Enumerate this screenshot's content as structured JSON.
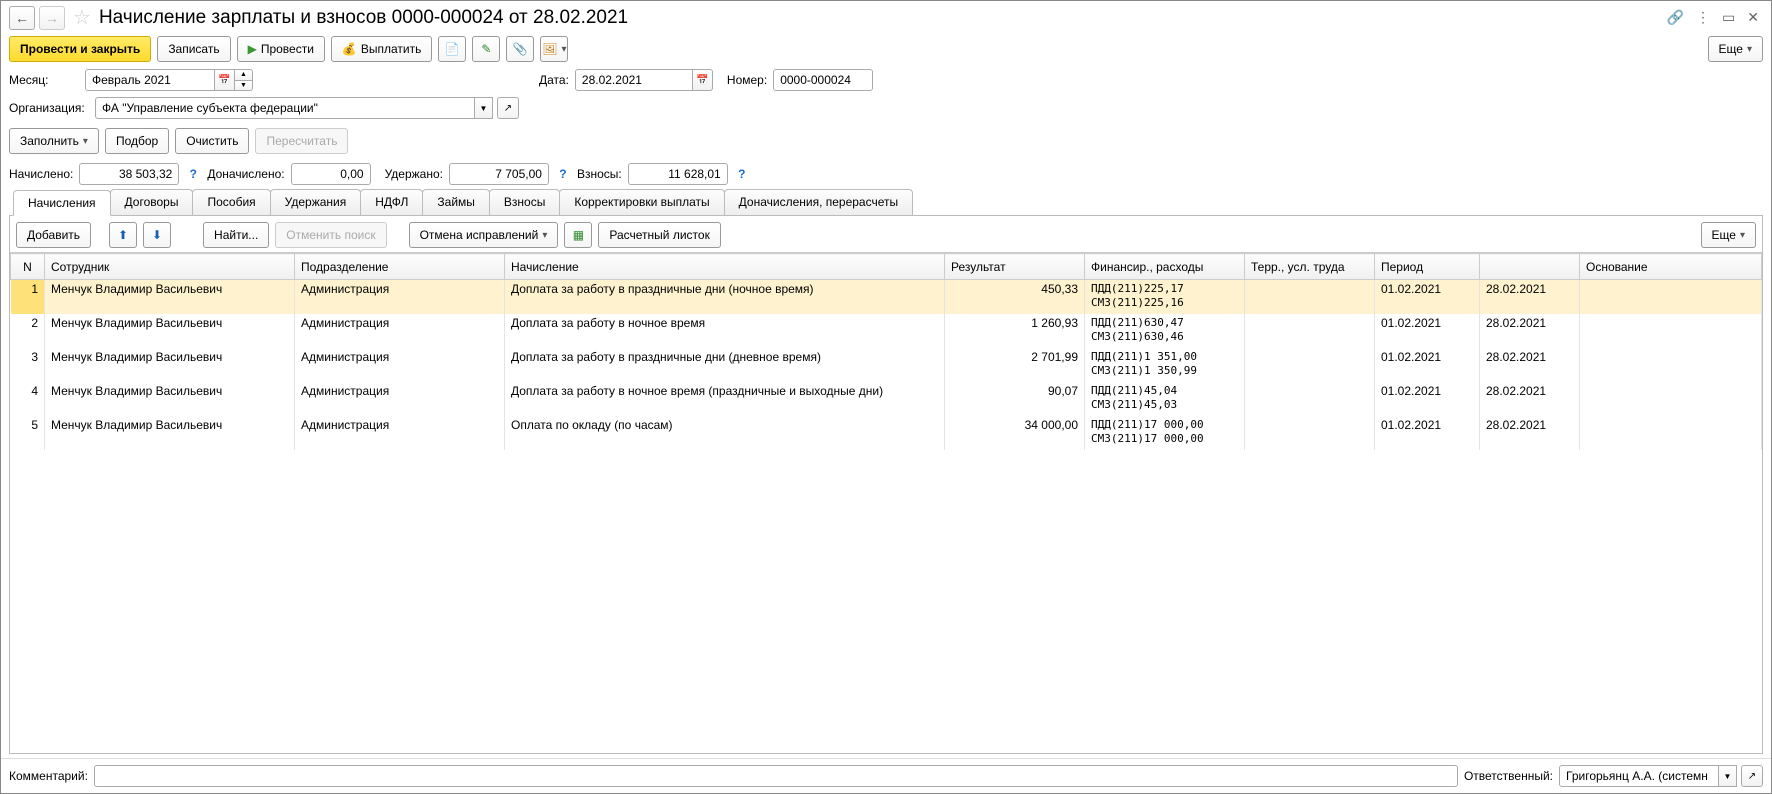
{
  "title": "Начисление зарплаты и взносов 0000-000024 от 28.02.2021",
  "toolbar": {
    "post_and_close": "Провести и закрыть",
    "save": "Записать",
    "post": "Провести",
    "pay": "Выплатить",
    "more": "Еще"
  },
  "fields": {
    "month_label": "Месяц:",
    "month_value": "Февраль 2021",
    "date_label": "Дата:",
    "date_value": "28.02.2021",
    "number_label": "Номер:",
    "number_value": "0000-000024",
    "org_label": "Организация:",
    "org_value": "ФА \"Управление субъекта федерации\""
  },
  "buttons_row": {
    "fill": "Заполнить",
    "pick": "Подбор",
    "clear": "Очистить",
    "recalc": "Пересчитать"
  },
  "totals": {
    "accrued_label": "Начислено:",
    "accrued_value": "38 503,32",
    "additional_label": "Доначислено:",
    "additional_value": "0,00",
    "withheld_label": "Удержано:",
    "withheld_value": "7 705,00",
    "contrib_label": "Взносы:",
    "contrib_value": "11 628,01"
  },
  "tabs": [
    {
      "id": "accruals",
      "label": "Начисления",
      "active": true
    },
    {
      "id": "contracts",
      "label": "Договоры"
    },
    {
      "id": "benefits",
      "label": "Пособия"
    },
    {
      "id": "deductions",
      "label": "Удержания"
    },
    {
      "id": "ndfl",
      "label": "НДФЛ"
    },
    {
      "id": "loans",
      "label": "Займы"
    },
    {
      "id": "contributions",
      "label": "Взносы"
    },
    {
      "id": "corr",
      "label": "Корректировки выплаты"
    },
    {
      "id": "recalc",
      "label": "Доначисления, перерасчеты"
    }
  ],
  "tab_toolbar": {
    "add": "Добавить",
    "find": "Найти...",
    "cancel_search": "Отменить поиск",
    "cancel_corrections": "Отмена исправлений",
    "payslip": "Расчетный листок",
    "more": "Еще"
  },
  "columns": {
    "n": "N",
    "employee": "Сотрудник",
    "department": "Подразделение",
    "accrual": "Начисление",
    "result": "Результат",
    "financing": "Финансир., расходы",
    "territory": "Терр., усл. труда",
    "period": "Период",
    "period2": "",
    "basis": "Основание"
  },
  "rows": [
    {
      "n": "1",
      "employee": "Менчук Владимир Васильевич",
      "department": "Администрация",
      "accrual": "Доплата за работу в праздничные дни (ночное время)",
      "result": "450,33",
      "fin": "ПДД(211)225,17\nСМЗ(211)225,16",
      "p1": "01.02.2021",
      "p2": "28.02.2021",
      "sel": true
    },
    {
      "n": "2",
      "employee": "Менчук Владимир Васильевич",
      "department": "Администрация",
      "accrual": "Доплата за работу в ночное время",
      "result": "1 260,93",
      "fin": "ПДД(211)630,47\nСМЗ(211)630,46",
      "p1": "01.02.2021",
      "p2": "28.02.2021"
    },
    {
      "n": "3",
      "employee": "Менчук Владимир Васильевич",
      "department": "Администрация",
      "accrual": "Доплата за работу в праздничные дни (дневное время)",
      "result": "2 701,99",
      "fin": "ПДД(211)1 351,00\nСМЗ(211)1 350,99",
      "p1": "01.02.2021",
      "p2": "28.02.2021"
    },
    {
      "n": "4",
      "employee": "Менчук Владимир Васильевич",
      "department": "Администрация",
      "accrual": "Доплата за работу в ночное время (праздничные и выходные дни)",
      "result": "90,07",
      "fin": "ПДД(211)45,04\nСМЗ(211)45,03",
      "p1": "01.02.2021",
      "p2": "28.02.2021"
    },
    {
      "n": "5",
      "employee": "Менчук Владимир Васильевич",
      "department": "Администрация",
      "accrual": "Оплата по окладу (по часам)",
      "result": "34 000,00",
      "fin": "ПДД(211)17 000,00\nСМЗ(211)17 000,00",
      "p1": "01.02.2021",
      "p2": "28.02.2021"
    }
  ],
  "footer": {
    "comment_label": "Комментарий:",
    "comment_value": "",
    "responsible_label": "Ответственный:",
    "responsible_value": "Григорьянц А.А. (системн"
  }
}
